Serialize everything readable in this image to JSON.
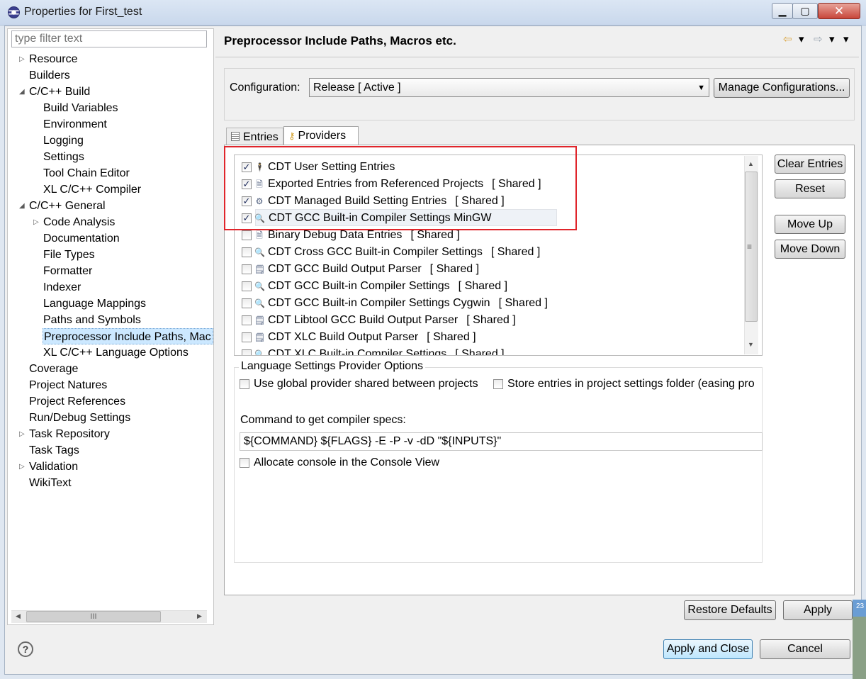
{
  "window": {
    "title": "Properties for First_test",
    "min": "▁",
    "max": "▢",
    "close": "✕"
  },
  "filter": {
    "placeholder": "type filter text"
  },
  "tree": [
    {
      "label": "Resource",
      "level": 0,
      "twisty": "right"
    },
    {
      "label": "Builders",
      "level": 0
    },
    {
      "label": "C/C++ Build",
      "level": 0,
      "twisty": "down"
    },
    {
      "label": "Build Variables",
      "level": 1
    },
    {
      "label": "Environment",
      "level": 1
    },
    {
      "label": "Logging",
      "level": 1
    },
    {
      "label": "Settings",
      "level": 1
    },
    {
      "label": "Tool Chain Editor",
      "level": 1
    },
    {
      "label": "XL C/C++ Compiler",
      "level": 1
    },
    {
      "label": "C/C++ General",
      "level": 0,
      "twisty": "down"
    },
    {
      "label": "Code Analysis",
      "level": 1,
      "twisty": "right"
    },
    {
      "label": "Documentation",
      "level": 1
    },
    {
      "label": "File Types",
      "level": 1
    },
    {
      "label": "Formatter",
      "level": 1
    },
    {
      "label": "Indexer",
      "level": 1
    },
    {
      "label": "Language Mappings",
      "level": 1
    },
    {
      "label": "Paths and Symbols",
      "level": 1
    },
    {
      "label": "Preprocessor Include Paths, Mac",
      "level": 1,
      "selected": true
    },
    {
      "label": "XL C/C++ Language Options",
      "level": 1
    },
    {
      "label": "Coverage",
      "level": 0
    },
    {
      "label": "Project Natures",
      "level": 0
    },
    {
      "label": "Project References",
      "level": 0
    },
    {
      "label": "Run/Debug Settings",
      "level": 0
    },
    {
      "label": "Task Repository",
      "level": 0,
      "twisty": "right"
    },
    {
      "label": "Task Tags",
      "level": 0
    },
    {
      "label": "Validation",
      "level": 0,
      "twisty": "right"
    },
    {
      "label": "WikiText",
      "level": 0
    }
  ],
  "page": {
    "title": "Preprocessor Include Paths, Macros etc."
  },
  "nav": {
    "back": "⇦",
    "forward": "⇨",
    "dropdown": "▾"
  },
  "config": {
    "label": "Configuration:",
    "selected": "Release  [ Active ]",
    "manage_button": "Manage Configurations..."
  },
  "tabs": [
    {
      "label": "Entries",
      "icon": "entries-icon"
    },
    {
      "label": "Providers",
      "icon": "key-icon",
      "active": true
    }
  ],
  "providers": [
    {
      "label": "CDT User Setting Entries",
      "shared": "",
      "checked": true,
      "icon": "user-icon",
      "glyph": "🕴"
    },
    {
      "label": "Exported Entries from Referenced Projects",
      "shared": "[ Shared ]",
      "checked": true,
      "icon": "document-icon",
      "glyph": "🗎"
    },
    {
      "label": "CDT Managed Build Setting Entries",
      "shared": "[ Shared ]",
      "checked": true,
      "icon": "build-icon",
      "glyph": "⚙"
    },
    {
      "label": "CDT GCC Built-in Compiler Settings MinGW",
      "shared": "",
      "checked": true,
      "icon": "compiler-icon",
      "glyph": "🔍",
      "selected": true
    },
    {
      "label": "Binary Debug Data Entries",
      "shared": "[ Shared ]",
      "checked": false,
      "icon": "document-icon",
      "glyph": "🗎"
    },
    {
      "label": "CDT Cross GCC Built-in Compiler Settings",
      "shared": "[ Shared ]",
      "checked": false,
      "icon": "compiler-icon",
      "glyph": "🔍"
    },
    {
      "label": "CDT GCC Build Output Parser",
      "shared": "[ Shared ]",
      "checked": false,
      "icon": "parser-icon",
      "glyph": "🗒"
    },
    {
      "label": "CDT GCC Built-in Compiler Settings",
      "shared": "[ Shared ]",
      "checked": false,
      "icon": "compiler-icon",
      "glyph": "🔍"
    },
    {
      "label": "CDT GCC Built-in Compiler Settings Cygwin",
      "shared": "[ Shared ]",
      "checked": false,
      "icon": "compiler-icon",
      "glyph": "🔍"
    },
    {
      "label": "CDT Libtool GCC Build Output Parser",
      "shared": "[ Shared ]",
      "checked": false,
      "icon": "parser-icon",
      "glyph": "🗒"
    },
    {
      "label": "CDT XLC Build Output Parser",
      "shared": "[ Shared ]",
      "checked": false,
      "icon": "parser-icon",
      "glyph": "🗒"
    },
    {
      "label": "CDT XLC Built-in Compiler Settings",
      "shared": "[ Shared ]",
      "checked": false,
      "icon": "compiler-icon",
      "glyph": "🔍"
    }
  ],
  "side_buttons": {
    "clear_entries": "Clear Entries",
    "reset": "Reset",
    "move_up": "Move Up",
    "move_down": "Move Down"
  },
  "options": {
    "legend": "Language Settings Provider Options",
    "use_global": "Use global provider shared between projects",
    "store_entries": "Store entries in project settings folder (easing pro",
    "cmd_label": "Command to get compiler specs:",
    "cmd_value": "${COMMAND} ${FLAGS} -E -P -v -dD \"${INPUTS}\"",
    "allocate_console": "Allocate console in the Console View"
  },
  "buttons": {
    "restore_defaults": "Restore Defaults",
    "apply": "Apply",
    "apply_close": "Apply and Close",
    "cancel": "Cancel"
  },
  "help": "?",
  "edge_number": "23",
  "scroll_grip": "III",
  "colors": {
    "highlight": "#e0252b",
    "selection": "#cce8ff"
  }
}
